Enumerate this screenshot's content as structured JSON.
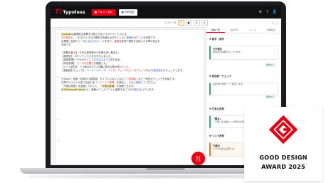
{
  "app": {
    "logo_mark": "T!",
    "logo_text": "Typoless",
    "tabs": [
      {
        "label": "■ テキスト校正",
        "active": true
      },
      {
        "label": "▣ PDF校正",
        "active": false
      }
    ],
    "top_icons": [
      "⚙",
      "?",
      "👤"
    ]
  },
  "toolbar": {
    "count": "◷ 70 / 1K",
    "buttons": [
      "✎",
      "■",
      "B",
      "≡"
    ],
    "right": [
      "↺",
      "⤢"
    ]
  },
  "editor": {
    "lines": [
      {
        "parts": [
          {
            "t": "Typoless",
            "s": "yellow"
          },
          {
            "t": "は新聞校正部署を中核とするテキストサービスです。",
            "s": ""
          }
        ]
      },
      {
        "parts": [
          {
            "t": "文字表記",
            "s": "red"
          },
          {
            "t": "に、これらのミスや口語的な言葉をAIがチェックし",
            "s": ""
          },
          {
            "t": "候補",
            "s": "blue"
          },
          {
            "t": "を示すことが可能です。",
            "s": ""
          }
        ]
      },
      {
        "parts": [
          {
            "t": "企業様ご自身でニーズに",
            "s": ""
          },
          {
            "t": "合わせたルール",
            "s": "blue"
          },
          {
            "t": "を作り、",
            "s": ""
          },
          {
            "t": "複雑",
            "s": "red"
          },
          {
            "t": "な辞書や規約を活用した文章の校正を",
            "s": ""
          }
        ]
      },
      {
        "parts": [
          {
            "t": "可能です。",
            "s": ""
          }
        ]
      },
      {
        "parts": [
          {
            "t": "",
            "s": ""
          }
        ]
      },
      {
        "parts": [
          {
            "t": "【校閲の",
            "s": ""
          },
          {
            "t": "観点",
            "s": "red"
          },
          {
            "t": "】・今日の記事数が今年最も多い数会だ。",
            "s": ""
          }
        ]
      },
      {
        "parts": [
          {
            "t": "【誤表記】・ボランティアに",
            "s": ""
          },
          {
            "t": "参加",
            "s": "green"
          },
          {
            "t": "を行いました。",
            "s": ""
          }
        ]
      },
      {
        "parts": [
          {
            "t": "【重複表現】・そもそもとして",
            "s": ""
          },
          {
            "t": "まずは今まで",
            "s": "blue"
          },
          {
            "t": "と振り返る。",
            "s": ""
          }
        ]
      },
      {
        "parts": [
          {
            "t": "【特定表現】・",
            "s": ""
          },
          {
            "t": "データの正確さ",
            "s": "red"
          },
          {
            "t": "を確認した。",
            "s": ""
          }
        ]
      },
      {
        "parts": [
          {
            "t": "【ルール自作】・ゴミ箱の中で1つの輪に膨大な数が揃っていく。",
            "s": ""
          }
        ]
      },
      {
        "parts": [
          {
            "t": "【表記揺れチェック】・",
            "s": ""
          },
          {
            "t": "ユーザーやユーザ",
            "s": "blue"
          },
          {
            "t": "、",
            "s": ""
          },
          {
            "t": "インターフェースやインタフェース",
            "s": "red"
          },
          {
            "t": "などの",
            "s": ""
          },
          {
            "t": "表記揺れ",
            "s": "blue"
          },
          {
            "t": "もチェックします。",
            "s": ""
          }
        ]
      },
      {
        "parts": [
          {
            "t": "",
            "s": ""
          }
        ]
      },
      {
        "parts": [
          {
            "t": "そのほか、固有・読書や口語表現、タイプミスなどに加えて「",
            "s": ""
          },
          {
            "t": "校閲者",
            "s": "red"
          },
          {
            "t": "」など一般的なチェックも可能です。",
            "s": ""
          }
        ]
      },
      {
        "parts": [
          {
            "t": "文章やテキストの中に含まれる「",
            "s": ""
          },
          {
            "t": "ハイリスク表現",
            "s": "red"
          },
          {
            "t": "」を検出し、さらに",
            "s": ""
          },
          {
            "t": "確認",
            "s": "blue"
          },
          {
            "t": "してください。",
            "s": ""
          }
        ]
      },
      {
        "parts": [
          {
            "t": "「不適切表現」を登録しておくと、「",
            "s": ""
          },
          {
            "t": "不適切表現",
            "s": "yellow"
          },
          {
            "t": "」を指摘できます。",
            "s": ""
          }
        ]
      },
      {
        "parts": [
          {
            "t": "またMicrosoft Word",
            "s": "yellow"
          },
          {
            "t": "など、",
            "s": ""
          },
          {
            "t": "各種オフィスソフト",
            "s": ""
          },
          {
            "t": "と連携することも",
            "s": ""
          },
          {
            "t": "可能",
            "s": "blue"
          },
          {
            "t": "となっています。",
            "s": ""
          }
        ]
      }
    ],
    "gutter": [
      "1",
      "5",
      "10",
      "15",
      "20",
      "25"
    ],
    "fab_line1": "校正",
    "fab_line2": "する"
  },
  "panel": {
    "tabs": [
      "指摘一覧",
      "表記ゆれ",
      "ルール",
      "辞書設定"
    ],
    "sections": [
      {
        "title": "▼ 誤字・脱字",
        "items": [
          {
            "title": "文字表記",
            "body": "誤表記の候補を示しています。",
            "pill": "置換する"
          }
        ]
      },
      {
        "title": "▼ 表記統一チェック",
        "items": [
          {
            "title": "",
            "body": "表記ゆれを統一して修正します。",
            "pill": "置換する"
          }
        ]
      },
      {
        "title": "▼ 冗長な表現",
        "items": [
          {
            "title": "「観点」",
            "body": "「今回」を主語にした場合の表現を見直すことを推奨します。",
            "pill": ""
          }
        ]
      },
      {
        "title": "▼ リスク表現",
        "items": [
          {
            "title": "不適切",
            "body": "リスクのある表現です。",
            "pill": "確認"
          }
        ]
      }
    ]
  },
  "badge": {
    "line1": "GOOD DESIGN",
    "line2": "AWARD 2025",
    "mark_color": "#e60012"
  },
  "colors": {
    "brand": "#e60012",
    "accent_green": "#38a86c",
    "accent_orange": "#e07a1a"
  }
}
